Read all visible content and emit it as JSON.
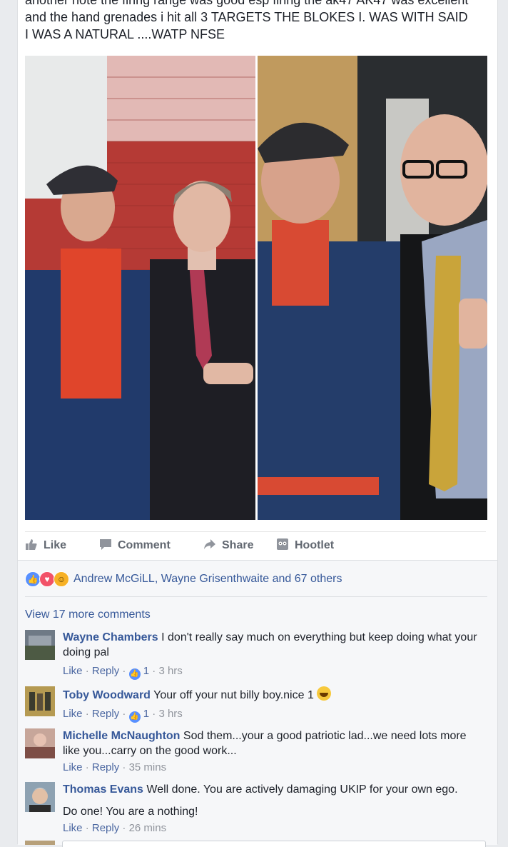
{
  "post": {
    "text_top_cut": "another note the firing range was good esp firing the ak47 AK47 was excellent",
    "text_line2": "and the hand grenades i hit all 3 TARGETS THE BLOKES I. WAS WITH SAID",
    "text_line3": "I WAS A NATURAL ....WATP NFSE"
  },
  "actions": {
    "like": "Like",
    "comment": "Comment",
    "share": "Share",
    "hootlet": "Hootlet"
  },
  "reactions": {
    "summary": "Andrew McGiLL, Wayne Grisenthwaite and 67 others"
  },
  "view_more": "View 17 more comments",
  "comments": [
    {
      "author": "Wayne Chambers",
      "text": "I don't really say much on everything but keep doing what your doing pal",
      "like": "Like",
      "reply": "Reply",
      "likes": "1",
      "time": "3 hrs"
    },
    {
      "author": "Toby Woodward",
      "text": "Your off your nut billy boy.nice 1",
      "like": "Like",
      "reply": "Reply",
      "likes": "1",
      "time": "3 hrs"
    },
    {
      "author": "Michelle McNaughton",
      "text": "Sod them...your a good patriotic lad...we need lots more like you...carry on the good work...",
      "like": "Like",
      "reply": "Reply",
      "time": "35 mins"
    },
    {
      "author": "Thomas Evans",
      "text": "Well done. You are actively damaging UKIP for your own ego.",
      "text2": "Do one! You are a nothing!",
      "like": "Like",
      "reply": "Reply",
      "time": "26 mins"
    }
  ],
  "colors": {
    "link": "#365899",
    "meta": "#90949c",
    "action": "#616770",
    "like_blue": "#5890ff",
    "love_red": "#f25268"
  }
}
